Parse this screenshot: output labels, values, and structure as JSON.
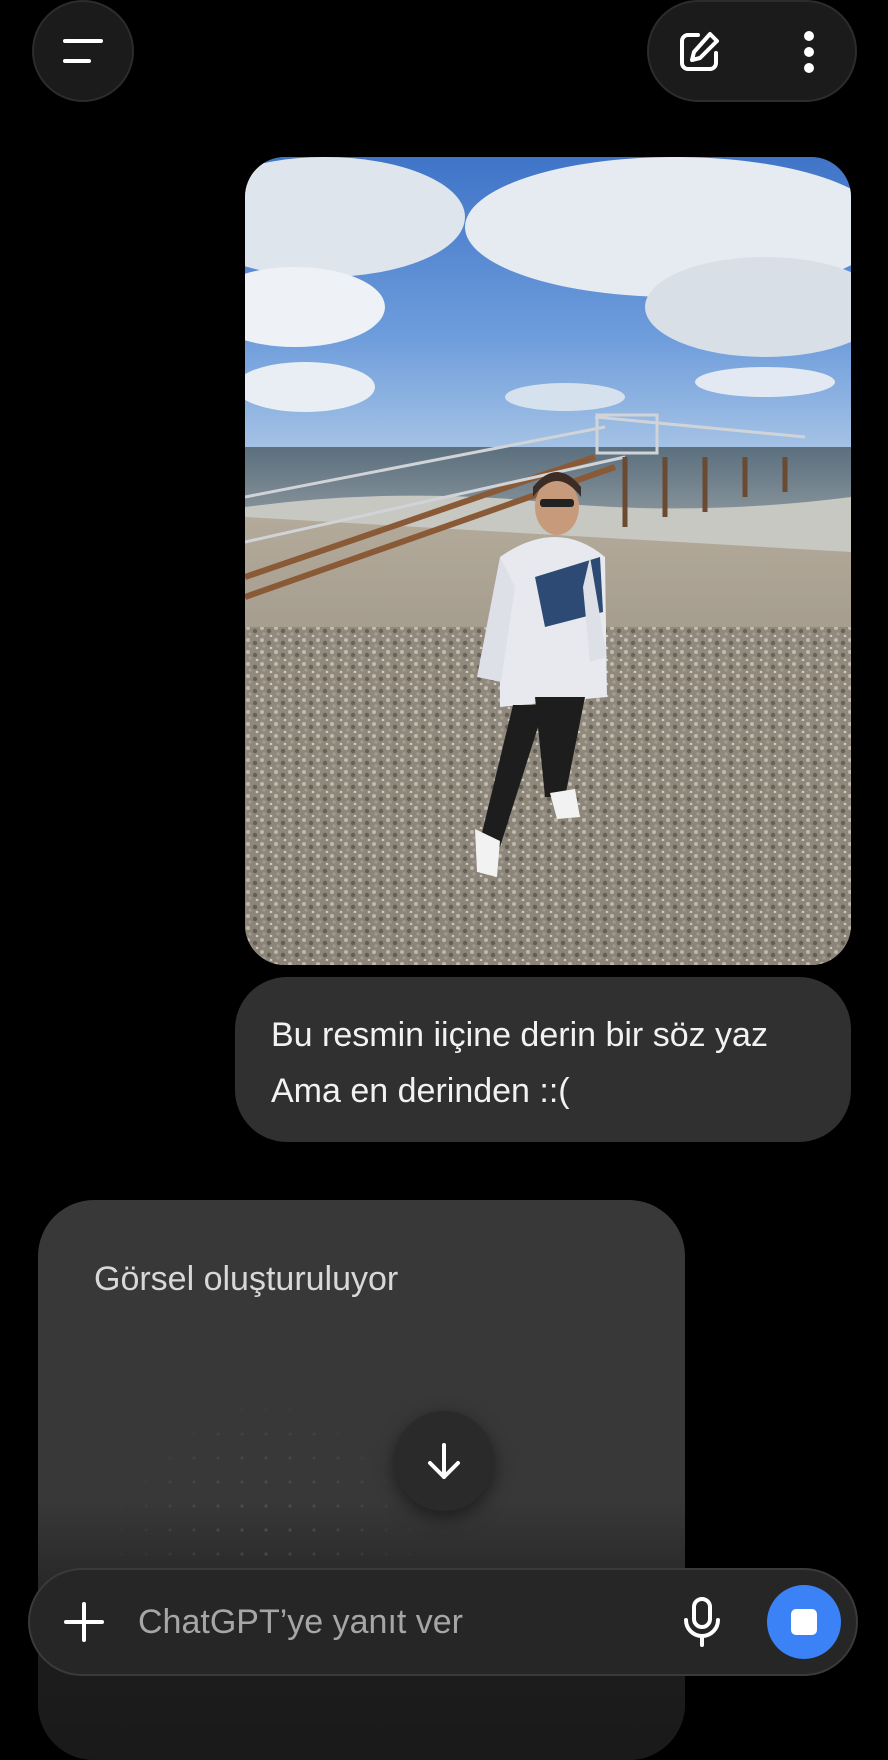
{
  "header": {
    "menu_icon": "sidebar-menu-icon",
    "new_chat_icon": "edit-icon",
    "more_icon": "kebab-menu-icon"
  },
  "conversation": {
    "user_image": {
      "icon": "beach-photo"
    },
    "user_message": {
      "lines": [
        "Bu resmin iiçine derin bir söz yaz",
        "Ama en derinden ::("
      ]
    },
    "assistant": {
      "status": "Görsel oluşturuluyor"
    }
  },
  "scroll_down_icon": "arrow-down-icon",
  "composer": {
    "placeholder": "ChatGPT’ye yanıt ver",
    "add_icon": "plus-icon",
    "mic_icon": "microphone-icon",
    "stop_icon": "stop-icon",
    "accent": "#3b82f6"
  }
}
